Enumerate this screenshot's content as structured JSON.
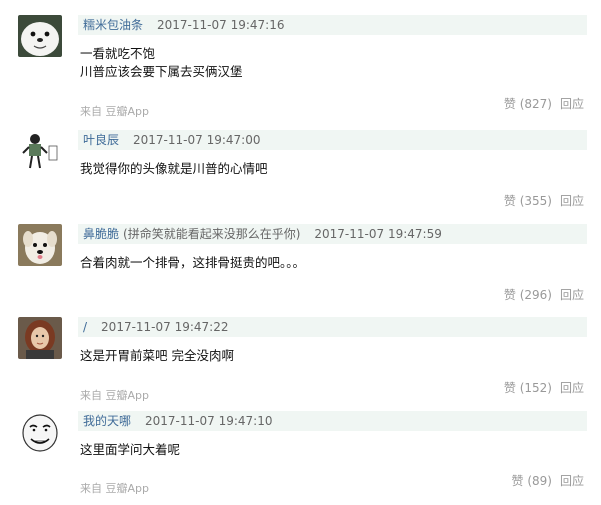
{
  "comments": [
    {
      "user": "糯米包油条",
      "signature": "",
      "time": "2017-11-07 19:47:16",
      "lines": [
        "一看就吃不饱",
        "川普应该会要下属去买俩汉堡"
      ],
      "source_prefix": "来自",
      "source_app": "豆瓣App",
      "likes": "赞 (827)",
      "reply": "回应",
      "avatar": "white-seal-avatar"
    },
    {
      "user": "叶良辰",
      "signature": "",
      "time": "2017-11-07 19:47:00",
      "lines": [
        "我觉得你的头像就是川普的心情吧"
      ],
      "source_prefix": "",
      "source_app": "",
      "likes": "赞 (355)",
      "reply": "回应",
      "avatar": "cartoon-figure-avatar"
    },
    {
      "user": "鼻脆脆",
      "signature": "(拼命笑就能看起来没那么在乎你)",
      "time": "2017-11-07 19:47:59",
      "lines": [
        "合着肉就一个排骨，这排骨挺贵的吧。。。"
      ],
      "source_prefix": "",
      "source_app": "",
      "likes": "赞 (296)",
      "reply": "回应",
      "avatar": "puppy-avatar"
    },
    {
      "user": "/",
      "signature": "",
      "time": "2017-11-07 19:47:22",
      "lines": [
        "这是开胃前菜吧 完全没肉啊"
      ],
      "source_prefix": "来自",
      "source_app": "豆瓣App",
      "likes": "赞 (152)",
      "reply": "回应",
      "avatar": "woman-portrait-avatar"
    },
    {
      "user": "我的天哪",
      "signature": "",
      "time": "2017-11-07 19:47:10",
      "lines": [
        "这里面学问大着呢"
      ],
      "source_prefix": "来自",
      "source_app": "豆瓣App",
      "likes": "赞 (89)",
      "reply": "回应",
      "avatar": "meme-face-avatar"
    }
  ]
}
